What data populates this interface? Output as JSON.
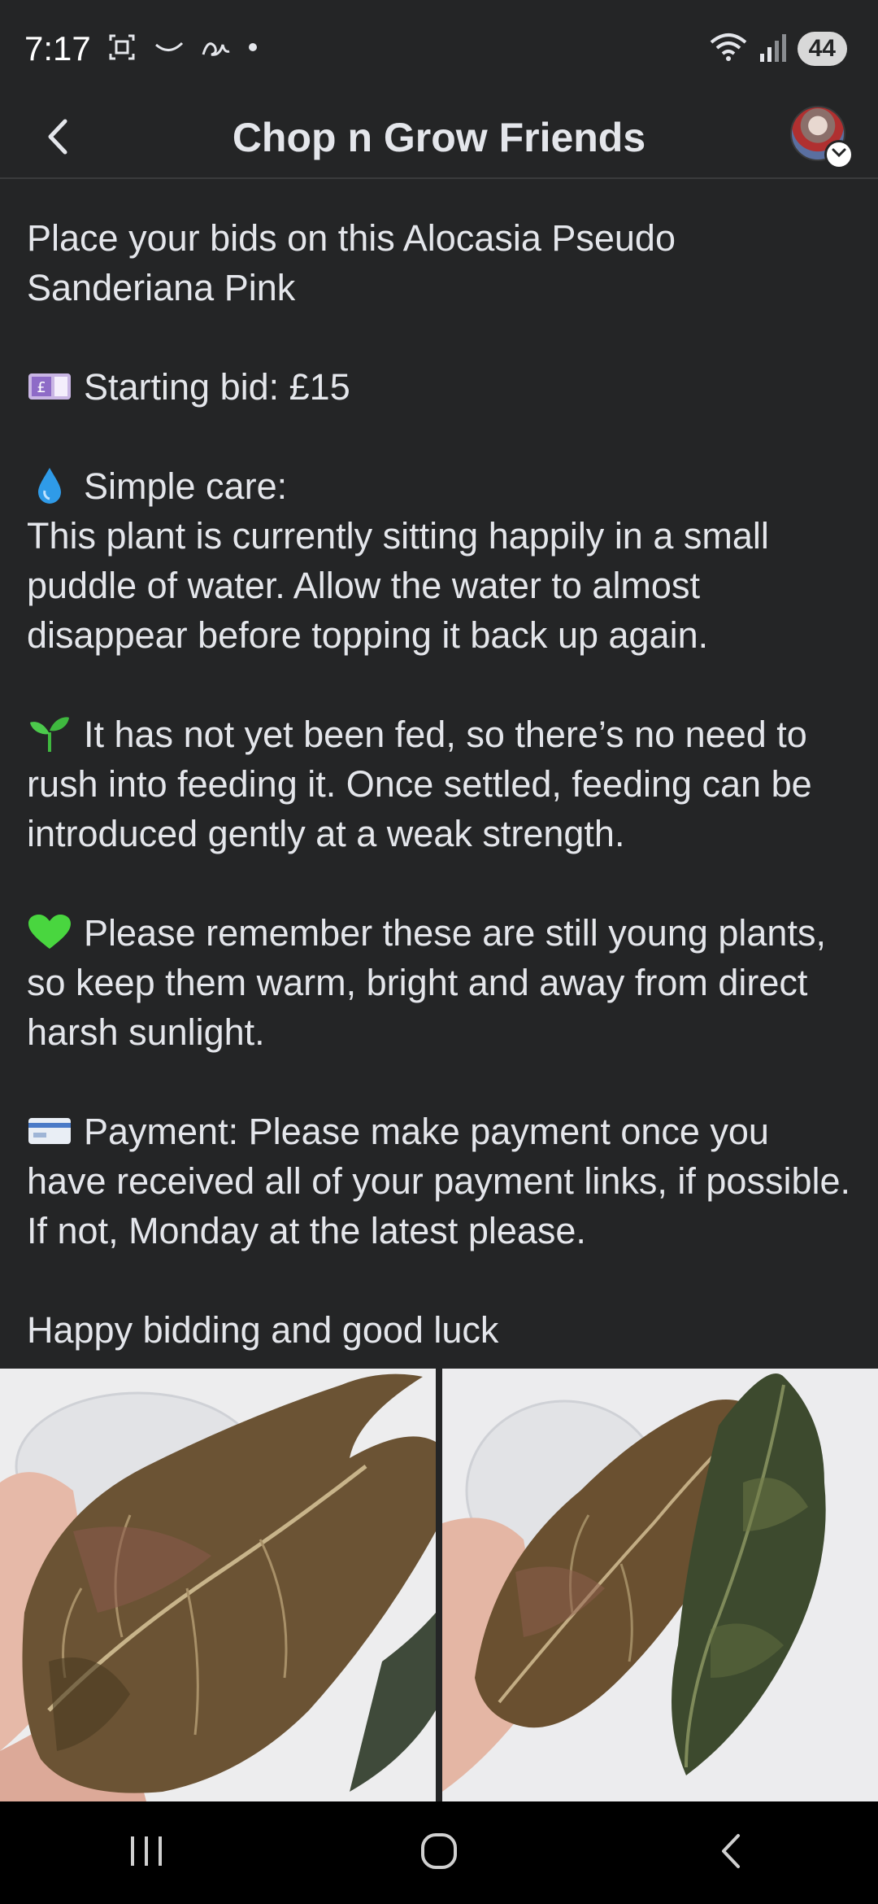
{
  "status_bar": {
    "time": "7:17",
    "battery": "44",
    "icons": [
      "screenshot-icon",
      "swoosh-icon",
      "script-icon",
      "dot-icon",
      "wifi-icon",
      "signal-icon",
      "battery-icon"
    ]
  },
  "header": {
    "title": "Chop n Grow Friends",
    "back_icon": "back-arrow-icon",
    "avatar_icon": "avatar",
    "dropdown_icon": "chevron-down-icon"
  },
  "post": {
    "intro": "Place your bids on this Alocasia Pseudo Sanderiana Pink",
    "starting_bid": "Starting bid: £15",
    "care_title": "Simple care:",
    "care_text": "This plant is currently sitting happily in a small puddle of water. Allow the water to almost disappear before topping it back up again.",
    "feeding_text": "It has not yet been fed, so there’s no need to rush into feeding it. Once settled, feeding can be introduced gently at a weak strength.",
    "remember_text": "Please remember these are still young plants, so keep them warm, bright and away from direct harsh sunlight.",
    "payment_text": "Payment: Please make payment once you have received all of your payment links, if possible. If not, Monday at the latest please.",
    "closing": "Happy bidding and good luck",
    "emojis": [
      "pound-banknote-icon",
      "droplet-icon",
      "seedling-icon",
      "green-heart-icon",
      "credit-card-icon"
    ]
  },
  "photos": [
    "plant-photo-1",
    "plant-photo-2"
  ],
  "nav_bar": {
    "icons": [
      "recent-apps-icon",
      "home-icon",
      "back-icon"
    ]
  },
  "colors": {
    "background": "#242526",
    "text": "#e4e6eb",
    "nav_background": "#000000"
  }
}
